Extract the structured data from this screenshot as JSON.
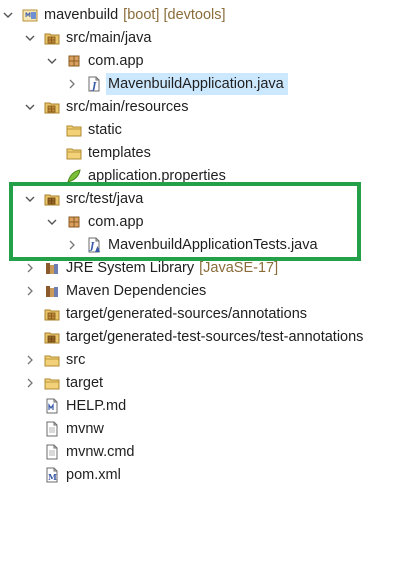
{
  "project": {
    "name": "mavenbuild",
    "decoration": "[boot] [devtools]"
  },
  "items": {
    "src_main_java": "src/main/java",
    "pkg_main": "com.app",
    "app_class": "MavenbuildApplication.java",
    "src_main_resources": "src/main/resources",
    "static_folder": "static",
    "templates_folder": "templates",
    "app_properties": "application.properties",
    "src_test_java": "src/test/java",
    "pkg_test": "com.app",
    "test_class": "MavenbuildApplicationTests.java",
    "jre_library": "JRE System Library",
    "jre_decoration": "[JavaSE-17]",
    "maven_deps": "Maven Dependencies",
    "gen_sources": "target/generated-sources/annotations",
    "gen_test_sources": "target/generated-test-sources/test-annotations",
    "src_folder": "src",
    "target_folder": "target",
    "help_md": "HELP.md",
    "mvnw": "mvnw",
    "mvnw_cmd": "mvnw.cmd",
    "pom_xml": "pom.xml"
  },
  "colors": {
    "highlight_border": "#24a148",
    "selection_bg": "#cce8ff",
    "decoration_text": "#8a6d3b"
  },
  "icons": {
    "project": "project-icon",
    "source_folder": "source-folder-icon",
    "package": "package-icon",
    "java_file": "java-file-icon",
    "folder": "folder-icon",
    "properties": "properties-file-icon",
    "library": "library-icon",
    "file": "text-file-icon",
    "xml": "xml-file-icon"
  }
}
